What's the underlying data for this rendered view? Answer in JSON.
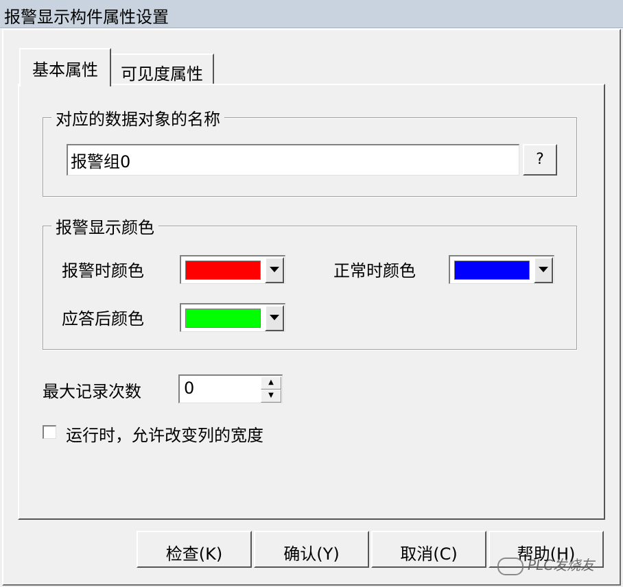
{
  "window": {
    "title": "报警显示构件属性设置"
  },
  "tabs": [
    {
      "label": "基本属性",
      "active": true
    },
    {
      "label": "可见度属性",
      "active": false
    }
  ],
  "data_object": {
    "legend": "对应的数据对象的名称",
    "value": "报警组0",
    "browse_label": "?"
  },
  "colors": {
    "legend": "报警显示颜色",
    "alarm_label": "报警时颜色",
    "alarm_color": "#ff0000",
    "normal_label": "正常时颜色",
    "normal_color": "#0000ff",
    "ack_label": "应答后颜色",
    "ack_color": "#00ff00"
  },
  "max_records": {
    "label": "最大记录次数",
    "value": "0"
  },
  "resize_option": {
    "label": "运行时，允许改变列的宽度",
    "checked": false
  },
  "buttons": {
    "check": "检查(K)",
    "confirm": "确认(Y)",
    "cancel": "取消(C)",
    "help": "帮助(H)"
  },
  "watermark": "PLC发烧友"
}
